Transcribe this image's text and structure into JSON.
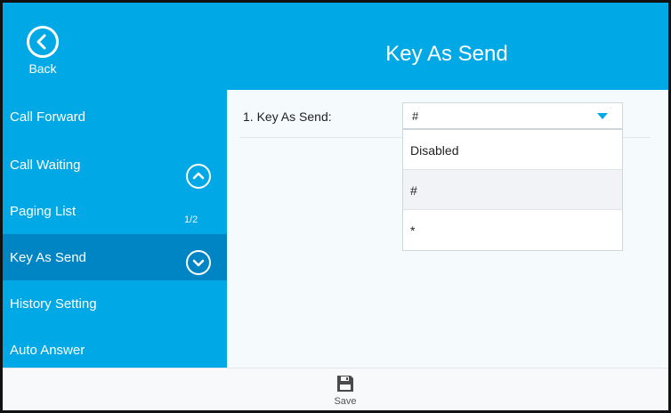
{
  "header": {
    "title": "Key As Send",
    "back_label": "Back",
    "back_icon": "chevron-left-circle-icon"
  },
  "sidebar": {
    "items": [
      {
        "label": "Call Forward"
      },
      {
        "label": "Call Waiting"
      },
      {
        "label": "Paging List"
      },
      {
        "label": "Key As Send",
        "active": true
      },
      {
        "label": "History Setting"
      },
      {
        "label": "Auto Answer"
      }
    ],
    "page_indicator": "1/2",
    "scroll_up_icon": "chevron-up-circle-icon",
    "scroll_down_icon": "chevron-down-circle-icon"
  },
  "setting": {
    "label": "1. Key As Send:",
    "value": "#"
  },
  "dropdown": {
    "options": [
      "Disabled",
      "#",
      "*"
    ],
    "selected": "#"
  },
  "bottom": {
    "save_label": "Save",
    "save_icon": "save-floppy-icon"
  },
  "colors": {
    "accent": "#00a8e6",
    "active_item": "#0085c4",
    "content_bg": "#f5fafd"
  }
}
